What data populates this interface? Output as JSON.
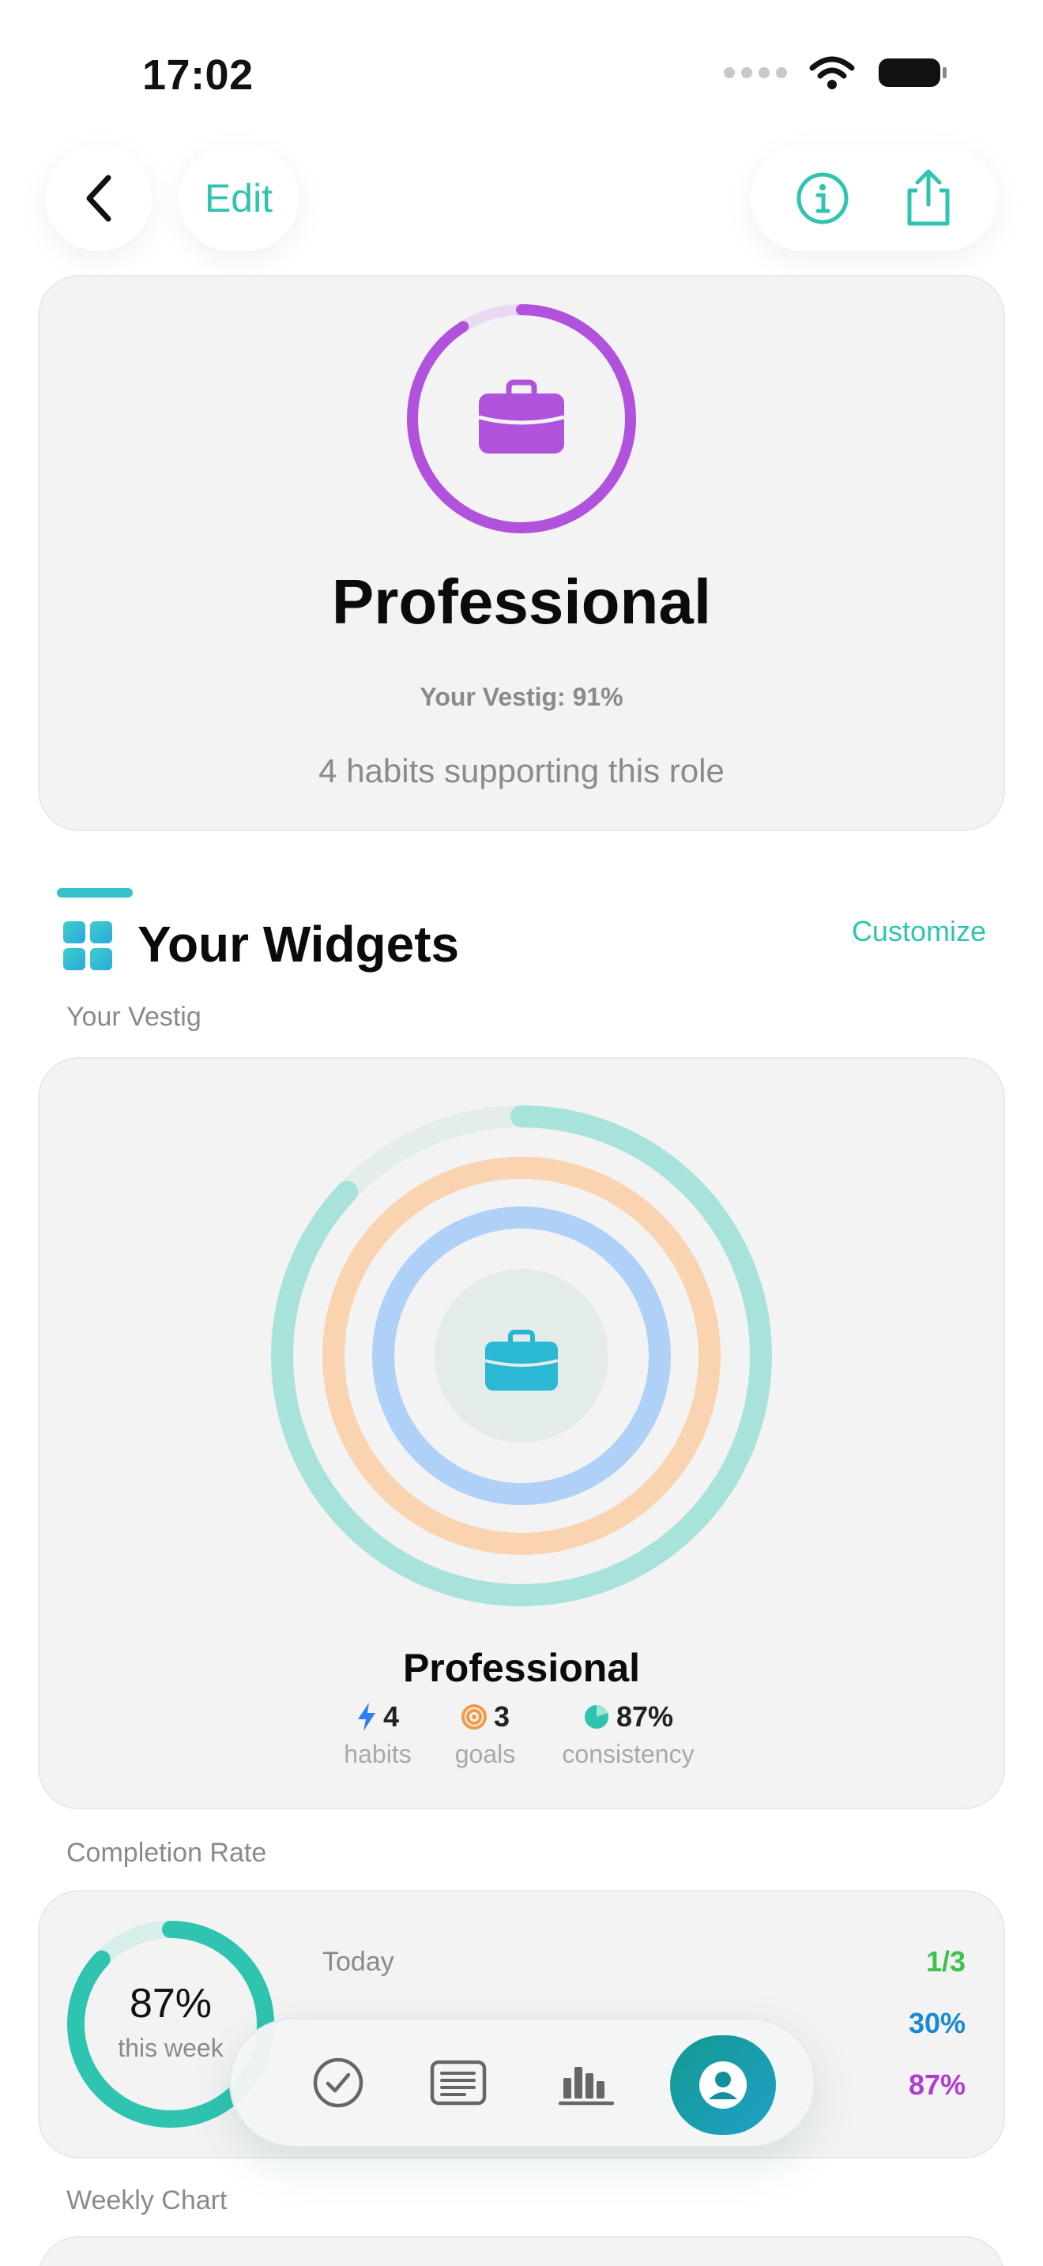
{
  "status_bar": {
    "time": "17:02"
  },
  "nav": {
    "edit_label": "Edit"
  },
  "role": {
    "title": "Professional",
    "vestig_text": "Your Vestig: 91%",
    "vestig_progress": 0.91,
    "habits_text": "4 habits supporting this role",
    "accent_color": "#b152dc"
  },
  "widgets": {
    "title": "Your Widgets",
    "customize_label": "Customize",
    "vestig_section_label": "Your Vestig",
    "vestig_widget": {
      "title": "Professional",
      "stats": [
        {
          "value": "4",
          "label": "habits",
          "icon": "bolt-icon",
          "color": "#2f7ff0"
        },
        {
          "value": "3",
          "label": "goals",
          "icon": "target-icon",
          "color": "#f29a4a"
        },
        {
          "value": "87%",
          "label": "consistency",
          "icon": "pie-icon",
          "color": "#2ec4b0"
        }
      ],
      "ring_colors": {
        "outer": "#9ee0d8",
        "middle": "#fbcfa8",
        "inner": "#a9cdf7"
      }
    },
    "completion_section_label": "Completion Rate",
    "completion": {
      "percent": "87%",
      "percent_value": 0.87,
      "period": "this week",
      "rows": [
        {
          "label": "Today",
          "value": "1/3",
          "color": "#3ec24f"
        },
        {
          "label": "",
          "value": "30%",
          "color": "#1a87d8"
        },
        {
          "label": "",
          "value": "87%",
          "color": "#b23bd1"
        }
      ]
    },
    "weekly_section_label": "Weekly Chart"
  },
  "tabbar": {
    "tabs": [
      {
        "icon": "check-circle-icon"
      },
      {
        "icon": "list-icon"
      },
      {
        "icon": "bar-chart-icon"
      },
      {
        "icon": "profile-icon",
        "active": true
      }
    ]
  }
}
